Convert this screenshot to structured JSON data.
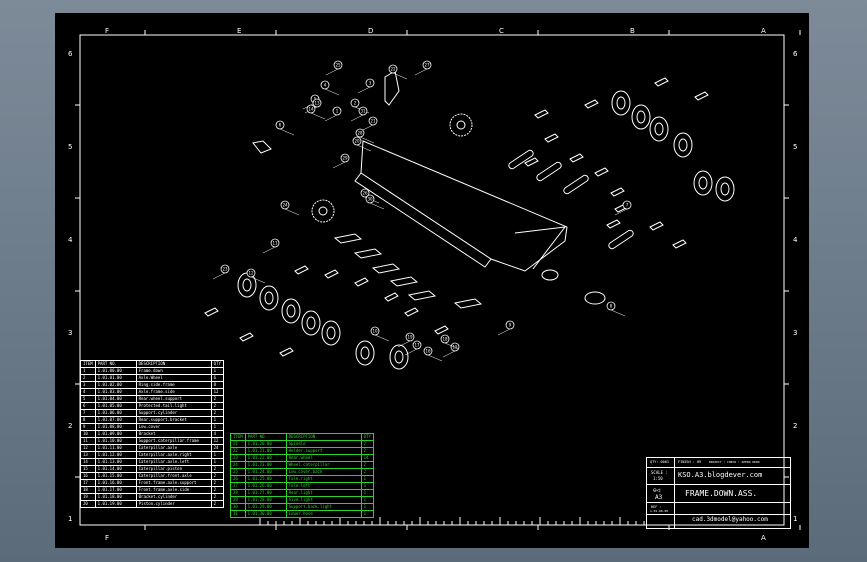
{
  "zones": {
    "columns": [
      "F",
      "E",
      "D",
      "C",
      "B",
      "A"
    ],
    "rows": [
      "6",
      "5",
      "4",
      "3",
      "2",
      "1"
    ]
  },
  "bom_header": {
    "item": "ITEM",
    "part": "PART NO.",
    "desc": "DESCRIPTION",
    "qty": "QTY"
  },
  "bom": [
    {
      "item": "1",
      "part": "1.01.00.00",
      "desc": "Frame.down",
      "qty": "1"
    },
    {
      "item": "2",
      "part": "1.01.01.00",
      "desc": "Axle.Wheel",
      "qty": "6"
    },
    {
      "item": "3",
      "part": "1.01.02.00",
      "desc": "Ring.side.frame",
      "qty": "8"
    },
    {
      "item": "4",
      "part": "1.01.03.00",
      "desc": "Axle.frame.side",
      "qty": "12"
    },
    {
      "item": "5",
      "part": "1.01.04.00",
      "desc": "Rear.wheel.support",
      "qty": "2"
    },
    {
      "item": "6",
      "part": "1.01.05.00",
      "desc": "Protected.tail.light",
      "qty": "2"
    },
    {
      "item": "7",
      "part": "1.01.06.00",
      "desc": "Support.cylinder",
      "qty": "2"
    },
    {
      "item": "8",
      "part": "1.01.07.00",
      "desc": "Rear.support.bracket",
      "qty": "1"
    },
    {
      "item": "9",
      "part": "1.01.08.00",
      "desc": "Low.cover",
      "qty": "1"
    },
    {
      "item": "10",
      "part": "1.01.09.00",
      "desc": "Bracket",
      "qty": "4"
    },
    {
      "item": "11",
      "part": "1.01.10.00",
      "desc": "Support.caterpillar.frame",
      "qty": "12"
    },
    {
      "item": "12",
      "part": "1.01.11.00",
      "desc": "Caterpillar.axle",
      "qty": "24"
    },
    {
      "item": "13",
      "part": "1.01.12.00",
      "desc": "Caterpillar.axle.right",
      "qty": "1"
    },
    {
      "item": "14",
      "part": "1.01.13.00",
      "desc": "Caterpillar.axle.left",
      "qty": "1"
    },
    {
      "item": "15",
      "part": "1.01.14.00",
      "desc": "Caterpillar.piston",
      "qty": "2"
    },
    {
      "item": "16",
      "part": "1.01.15.00",
      "desc": "Caterpillar.front.axle",
      "qty": "2"
    },
    {
      "item": "17",
      "part": "1.01.16.00",
      "desc": "Front.frame.axle.support",
      "qty": "2"
    },
    {
      "item": "18",
      "part": "1.01.17.00",
      "desc": "Front.frame.axle.side",
      "qty": "2"
    },
    {
      "item": "19",
      "part": "1.01.18.00",
      "desc": "Bracket.cylinder",
      "qty": "2"
    },
    {
      "item": "20",
      "part": "1.01.19.00",
      "desc": "Piston.cylinder",
      "qty": "2"
    }
  ],
  "bom2": [
    {
      "item": "21",
      "part": "1.01.20.00",
      "desc": "Spindle",
      "qty": "2"
    },
    {
      "item": "22",
      "part": "1.01.21.00",
      "desc": "Holder.support",
      "qty": "2"
    },
    {
      "item": "23",
      "part": "1.01.22.00",
      "desc": "Rear.wheel",
      "qty": "14"
    },
    {
      "item": "24",
      "part": "1.01.23.00",
      "desc": "Wheel.caterpillar",
      "qty": "2"
    },
    {
      "item": "25",
      "part": "1.01.24.00",
      "desc": "Low.cover.back",
      "qty": "2"
    },
    {
      "item": "26",
      "part": "1.01.25.00",
      "desc": "Tole.right",
      "qty": "1"
    },
    {
      "item": "27",
      "part": "1.01.26.00",
      "desc": "Tole.left",
      "qty": "1"
    },
    {
      "item": "28",
      "part": "1.01.27.00",
      "desc": "Rear.light",
      "qty": "1"
    },
    {
      "item": "29",
      "part": "1.01.28.00",
      "desc": "Sive.light",
      "qty": "1"
    },
    {
      "item": "30",
      "part": "1.01.29.00",
      "desc": "Support.back.light",
      "qty": "1"
    },
    {
      "item": "31",
      "part": "1.01.30.00",
      "desc": "Lower.hose",
      "qty": "1"
    }
  ],
  "title_block": {
    "qty_label": "QTY: 0001",
    "finish": "FINISH : 09",
    "notes": "PROJECT : CHECK : APPRO DDDD",
    "scale_label": "SCALE :",
    "scale": "1:50",
    "site": "KSO.A3.blogdever.com",
    "size": "A3",
    "title": "FRAME.DOWN.ASS.",
    "ref_label": "REF :",
    "ref": "1.01.00.00",
    "email": "cad.3dmodel@yahoo.com"
  },
  "callouts": [
    "1",
    "2",
    "3",
    "4",
    "5",
    "6",
    "7",
    "8",
    "9",
    "10",
    "11",
    "12",
    "13",
    "14",
    "15",
    "16",
    "17",
    "18",
    "19",
    "20",
    "21",
    "22",
    "23",
    "24",
    "25",
    "26",
    "27",
    "28",
    "29",
    "30",
    "31"
  ]
}
